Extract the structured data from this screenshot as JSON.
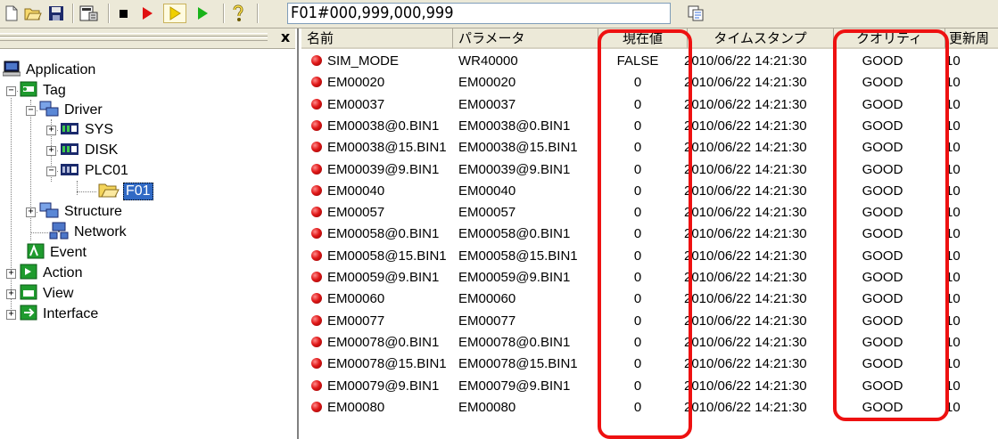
{
  "toolbar": {
    "path": "F01#000,999,000,999",
    "icons": [
      "new-icon",
      "open-icon",
      "save-icon",
      "properties-icon",
      "stop-icon",
      "run-icon",
      "step-icon",
      "play-icon",
      "help-icon",
      "copy-icon"
    ]
  },
  "tree": {
    "close_label": "x",
    "nodes": [
      {
        "label": "Application"
      },
      {
        "label": "Tag"
      },
      {
        "label": "Driver"
      },
      {
        "label": "SYS"
      },
      {
        "label": "DISK"
      },
      {
        "label": "PLC01"
      },
      {
        "label": "F01"
      },
      {
        "label": "Structure"
      },
      {
        "label": "Network"
      },
      {
        "label": "Event"
      },
      {
        "label": "Action"
      },
      {
        "label": "View"
      },
      {
        "label": "Interface"
      }
    ]
  },
  "list": {
    "columns": [
      "名前",
      "パラメータ",
      "現在値",
      "タイムスタンプ",
      "クオリティ",
      "更新周"
    ],
    "rows": [
      {
        "name": "SIM_MODE",
        "param": "WR40000",
        "value": "FALSE",
        "ts": "2010/06/22 14:21:30",
        "quality": "GOOD",
        "update": "10"
      },
      {
        "name": "EM00020",
        "param": "EM00020",
        "value": "0",
        "ts": "2010/06/22 14:21:30",
        "quality": "GOOD",
        "update": "10"
      },
      {
        "name": "EM00037",
        "param": "EM00037",
        "value": "0",
        "ts": "2010/06/22 14:21:30",
        "quality": "GOOD",
        "update": "10"
      },
      {
        "name": "EM00038@0.BIN1",
        "param": "EM00038@0.BIN1",
        "value": "0",
        "ts": "2010/06/22 14:21:30",
        "quality": "GOOD",
        "update": "10"
      },
      {
        "name": "EM00038@15.BIN1",
        "param": "EM00038@15.BIN1",
        "value": "0",
        "ts": "2010/06/22 14:21:30",
        "quality": "GOOD",
        "update": "10"
      },
      {
        "name": "EM00039@9.BIN1",
        "param": "EM00039@9.BIN1",
        "value": "0",
        "ts": "2010/06/22 14:21:30",
        "quality": "GOOD",
        "update": "10"
      },
      {
        "name": "EM00040",
        "param": "EM00040",
        "value": "0",
        "ts": "2010/06/22 14:21:30",
        "quality": "GOOD",
        "update": "10"
      },
      {
        "name": "EM00057",
        "param": "EM00057",
        "value": "0",
        "ts": "2010/06/22 14:21:30",
        "quality": "GOOD",
        "update": "10"
      },
      {
        "name": "EM00058@0.BIN1",
        "param": "EM00058@0.BIN1",
        "value": "0",
        "ts": "2010/06/22 14:21:30",
        "quality": "GOOD",
        "update": "10"
      },
      {
        "name": "EM00058@15.BIN1",
        "param": "EM00058@15.BIN1",
        "value": "0",
        "ts": "2010/06/22 14:21:30",
        "quality": "GOOD",
        "update": "10"
      },
      {
        "name": "EM00059@9.BIN1",
        "param": "EM00059@9.BIN1",
        "value": "0",
        "ts": "2010/06/22 14:21:30",
        "quality": "GOOD",
        "update": "10"
      },
      {
        "name": "EM00060",
        "param": "EM00060",
        "value": "0",
        "ts": "2010/06/22 14:21:30",
        "quality": "GOOD",
        "update": "10"
      },
      {
        "name": "EM00077",
        "param": "EM00077",
        "value": "0",
        "ts": "2010/06/22 14:21:30",
        "quality": "GOOD",
        "update": "10"
      },
      {
        "name": "EM00078@0.BIN1",
        "param": "EM00078@0.BIN1",
        "value": "0",
        "ts": "2010/06/22 14:21:30",
        "quality": "GOOD",
        "update": "10"
      },
      {
        "name": "EM00078@15.BIN1",
        "param": "EM00078@15.BIN1",
        "value": "0",
        "ts": "2010/06/22 14:21:30",
        "quality": "GOOD",
        "update": "10"
      },
      {
        "name": "EM00079@9.BIN1",
        "param": "EM00079@9.BIN1",
        "value": "0",
        "ts": "2010/06/22 14:21:30",
        "quality": "GOOD",
        "update": "10"
      },
      {
        "name": "EM00080",
        "param": "EM00080",
        "value": "0",
        "ts": "2010/06/22 14:21:30",
        "quality": "GOOD",
        "update": "10"
      }
    ]
  },
  "colors": {
    "highlight": "#ee1111",
    "selection": "#316ac5",
    "status_dot": "#e01818"
  }
}
